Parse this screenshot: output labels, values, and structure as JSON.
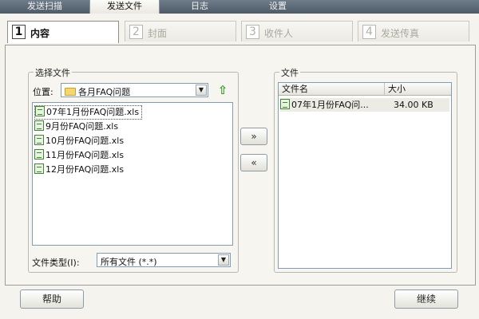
{
  "top_tabs": [
    {
      "label": "发送扫描"
    },
    {
      "label": "发送文件"
    },
    {
      "label": "日志"
    },
    {
      "label": "设置"
    }
  ],
  "steps": [
    {
      "num": "1",
      "label": "内容"
    },
    {
      "num": "2",
      "label": "封面"
    },
    {
      "num": "3",
      "label": "收件人"
    },
    {
      "num": "4",
      "label": "发送传真"
    }
  ],
  "select_files": {
    "title": "选择文件",
    "location_label": "位置:",
    "location_value": "各月FAQ问题",
    "files": [
      {
        "name": "07年1月份FAQ问题.xls"
      },
      {
        "name": "9月份FAQ问题.xls"
      },
      {
        "name": "10月份FAQ问题.xls"
      },
      {
        "name": "11月份FAQ问题.xls"
      },
      {
        "name": "12月份FAQ问题.xls"
      }
    ],
    "type_label": "文件类型(I):",
    "type_value": "所有文件 (*.*)"
  },
  "move_buttons": {
    "add": "»",
    "remove": "«"
  },
  "files_panel": {
    "title": "文件",
    "columns": [
      "文件名",
      "大小"
    ],
    "rows": [
      {
        "name": "07年1月份FAQ问...",
        "size": "34.00 KB"
      }
    ]
  },
  "buttons": {
    "help": "帮助",
    "next": "继续"
  },
  "icons": {
    "file": "xls-file-icon",
    "folder": "folder-icon",
    "up": "up-folder-icon"
  }
}
